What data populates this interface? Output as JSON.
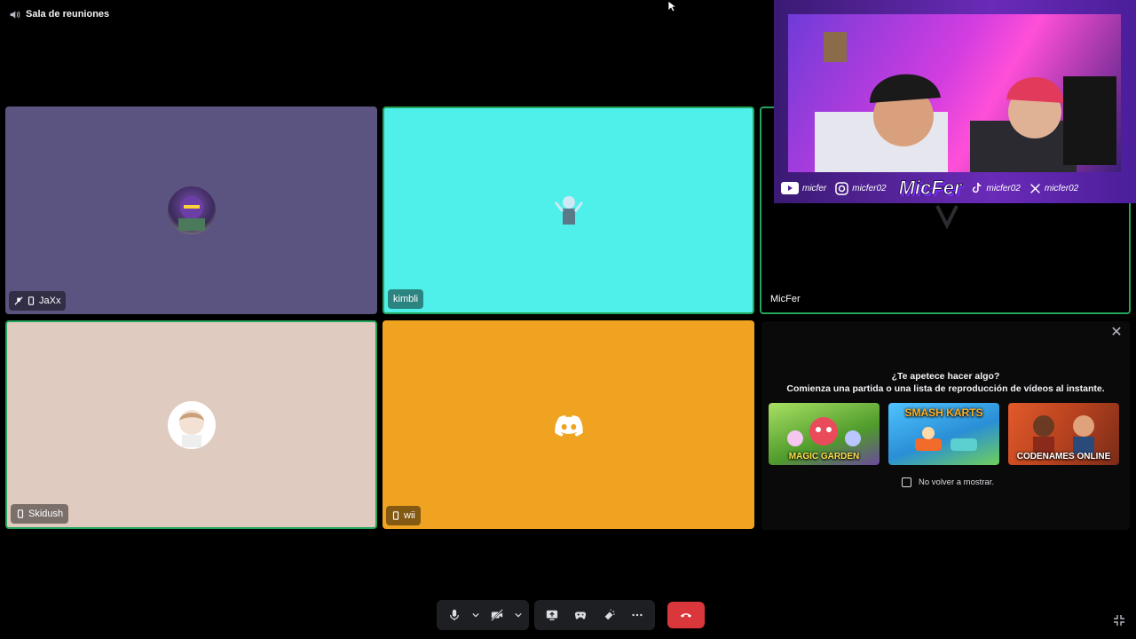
{
  "channel": {
    "name": "Sala de reuniones",
    "icon": "speaker-icon"
  },
  "tiles": [
    {
      "name": "JaXx",
      "bg": "#5b5480",
      "muted": true,
      "mobile": true,
      "speaking": false
    },
    {
      "name": "kimbli",
      "bg": "#4ff0ea",
      "muted": false,
      "mobile": false,
      "speaking": true
    },
    {
      "name": "MicFer",
      "bg": "#000000",
      "muted": false,
      "mobile": false,
      "speaking": true
    },
    {
      "name": "Skidush",
      "bg": "#e0cbc1",
      "muted": false,
      "mobile": true,
      "speaking": true
    },
    {
      "name": "wii",
      "bg": "#f0a321",
      "muted": false,
      "mobile": true,
      "speaking": false
    }
  ],
  "activity": {
    "title": "¿Te apetece hacer algo?",
    "subtitle": "Comienza una partida o una lista de reproducción de vídeos al instante.",
    "games": [
      {
        "label": "MAGIC GARDEN",
        "color": "#6fcf3b"
      },
      {
        "label": "SMASH KARTS",
        "color": "#38b6f0"
      },
      {
        "label": "CODENAMES ONLINE",
        "color": "#d9542a"
      }
    ],
    "dont_show": "No volver a mostrar."
  },
  "stream_overlay": {
    "youtube": "micfer",
    "instagram": "micfer02",
    "brand": "MicFer",
    "tiktok": "micfer02",
    "x": "micfer02"
  },
  "controls": {
    "mic": "microphone-icon",
    "camera": "camera-off-icon",
    "screenshare": "screen-share-icon",
    "activity": "gamepad-icon",
    "soundboard": "soundboard-icon",
    "more": "more-icon",
    "disconnect": "hang-up-icon"
  }
}
